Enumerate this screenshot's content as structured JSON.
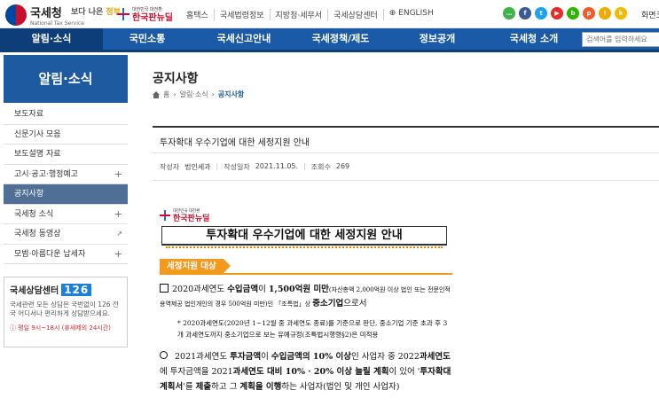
{
  "header": {
    "logo_text": "국세청",
    "logo_sub": "National Tax Service",
    "brand2_a": "보다 나은 ",
    "brand2_b": "정부",
    "brand3_small": "대한민국 대전환",
    "brand3_text": "한국판뉴딜",
    "links": [
      "홈택스",
      "국세법령정보",
      "지방청·세무서",
      "국세상담센터",
      "⊕ ENGLISH"
    ],
    "sitemap": "화면크",
    "social": [
      {
        "name": "chat-icon",
        "label": "…",
        "color": "#3db34a"
      },
      {
        "name": "facebook-icon",
        "label": "f",
        "color": "#3b5998"
      },
      {
        "name": "twitter-icon",
        "label": "t",
        "color": "#1da1f2"
      },
      {
        "name": "youtube-icon",
        "label": "▶",
        "color": "#e52d27"
      },
      {
        "name": "blog-icon",
        "label": "b",
        "color": "#2db400"
      },
      {
        "name": "post-icon",
        "label": "p",
        "color": "#ef5b2a"
      },
      {
        "name": "alarm-icon",
        "label": "!",
        "color": "#f2a900"
      },
      {
        "name": "kakao-icon",
        "label": "k",
        "color": "#f5b800"
      }
    ]
  },
  "nav": {
    "items": [
      "알림·소식",
      "국민소통",
      "국세신고안내",
      "국세정책/제도",
      "정보공개",
      "국세청 소개"
    ],
    "search_placeholder": "검색어를 입력하세요"
  },
  "sidebar": {
    "title": "알림·소식",
    "items": [
      {
        "label": "보도자료",
        "icon": ""
      },
      {
        "label": "신문기사 모음",
        "icon": ""
      },
      {
        "label": "보도설명 자료",
        "icon": ""
      },
      {
        "label": "고시·공고·행정예고",
        "icon": "+"
      },
      {
        "label": "공지사항",
        "icon": ""
      },
      {
        "label": "국세청 소식",
        "icon": "+"
      },
      {
        "label": "국세청 동영상",
        "icon": "↗"
      },
      {
        "label": "모범·아름다운 납세자",
        "icon": "+"
      }
    ],
    "call_title": "국세상담센터",
    "call_number": "126",
    "call_desc": "국세관련 모든 상담은 국번없이 126 전국 어디서나 편리하게 상담받으세요.",
    "call_hours": "ⓘ 평일 9시~18시 (휴세제외 24시간)"
  },
  "content": {
    "page_title": "공지사항",
    "crumb": [
      "홈",
      "알림·소식",
      "공지사항"
    ],
    "post_title": "투자확대 우수기업에 대한 세정지원 안내",
    "meta": {
      "author_label": "작성자",
      "author": "법인세과",
      "date_label": "작성일자",
      "date": "2021.11.05.",
      "views_label": "조회수",
      "views": "269"
    }
  },
  "document": {
    "logo_small": "대한민국 대전환",
    "logo_text": "한국판뉴딜",
    "heading": "투자확대 우수기업에 대한 세정지원 안내",
    "badge": "세정지원 대상",
    "b1_a": "2020과세연도 ",
    "b1_b": "수입금액",
    "b1_c": "이 ",
    "b1_d": "1,500억원 미만",
    "b1_e": "(자산총액 2,000억원 이상 법인 또는 전문인적용역제공 법인개인의 경우 500억원 미만)인 「조특법」상 ",
    "b1_f": "중소기업",
    "b1_g": "으로서",
    "sub": "* 2020과세연도(2020년 1~12월 중 과세연도 종료)를 기준으로 판단, 중소기업 기준 초과 후 3개 과세연도까지 중소기업으로 보는 유예규정(조특법시행령§2)은 미적용",
    "b2_a": "2021과세연도 ",
    "b2_b": "투자금액",
    "b2_c": "이 ",
    "b2_d": "수입금액의 10% 이상",
    "b2_e": "인 사업자 중 2022",
    "b2_f": "과세연도",
    "b2_g": "에 투자금액을 2021",
    "b2_h": "과세연도 대비 10% · 20% 이상 늘릴 계획",
    "b2_i": "이 있어 '",
    "b2_j": "투자확대계획서",
    "b2_k": "'를 ",
    "b2_l": "제출",
    "b2_m": "하고 그 ",
    "b2_n": "계획을 이행",
    "b2_o": "하는 사업자(법인 및 개인 사업자)"
  }
}
